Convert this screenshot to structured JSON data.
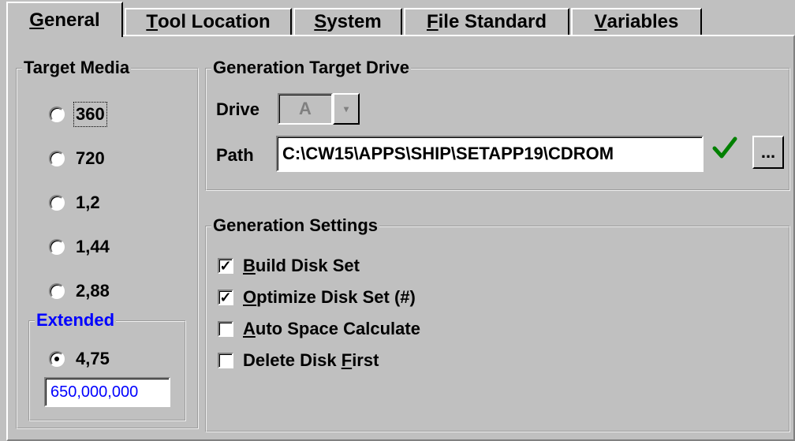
{
  "tabs": [
    {
      "label": "General",
      "accel": "G",
      "rest": "eneral",
      "active": true
    },
    {
      "label": "Tool Location",
      "accel": "T",
      "rest": "ool Location"
    },
    {
      "label": "System",
      "accel": "S",
      "rest": "ystem"
    },
    {
      "label": "File Standard",
      "accel": "F",
      "rest": "ile Standard"
    },
    {
      "label": "Variables",
      "accel": "V",
      "rest": "ariables"
    }
  ],
  "target_media": {
    "title": "Target Media",
    "options": [
      "360",
      "720",
      "1,2",
      "1,44",
      "2,88"
    ],
    "extended": {
      "title": "Extended",
      "option": "4,75",
      "value": "650,000,000"
    }
  },
  "target_drive": {
    "title": "Generation Target Drive",
    "drive_label": "Drive",
    "drive_value": "A",
    "path_label": "Path",
    "path_value": "C:\\CW15\\APPS\\SHIP\\SETAPP19\\CDROM",
    "browse_label": "..."
  },
  "settings": {
    "title": "Generation Settings",
    "items": [
      {
        "prefix": "",
        "accel": "B",
        "rest": "uild Disk Set",
        "checked": true
      },
      {
        "prefix": "",
        "accel": "O",
        "rest": "ptimize Disk Set (#)",
        "checked": true
      },
      {
        "prefix": "",
        "accel": "A",
        "rest": "uto Space Calculate",
        "checked": false
      },
      {
        "prefix": "Delete Disk ",
        "accel": "F",
        "rest": "irst",
        "checked": false
      }
    ]
  },
  "colors": {
    "accent_blue": "#0000ff",
    "check_green": "#008000"
  }
}
